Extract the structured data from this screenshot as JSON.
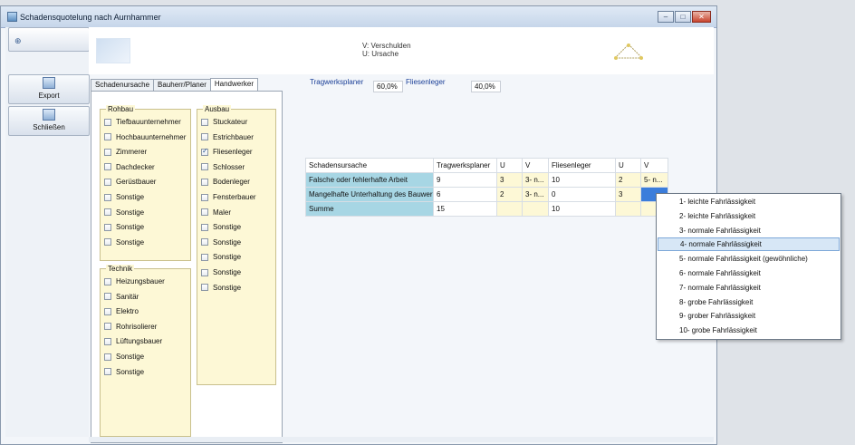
{
  "window": {
    "title": "Schadensquotelung nach Aurnhammer",
    "controls": {
      "minimize": "–",
      "maximize": "□",
      "close": "✕"
    }
  },
  "sidebar": {
    "pin_icon": "pin-icon",
    "export_label": "Export",
    "close_label": "Schließen"
  },
  "header": {
    "legend_v": "V: Verschulden",
    "legend_u": "U: Ursache"
  },
  "tabs": [
    {
      "label": "Schadenursache",
      "active": false
    },
    {
      "label": "Bauherr/Planer",
      "active": false
    },
    {
      "label": "Handwerker",
      "active": true
    }
  ],
  "groups": {
    "rohbau": {
      "title": "Rohbau",
      "items": [
        {
          "label": "Tiefbauunternehmer",
          "checked": false
        },
        {
          "label": "Hochbauunternehmer",
          "checked": false
        },
        {
          "label": "Zimmerer",
          "checked": false
        },
        {
          "label": "Dachdecker",
          "checked": false
        },
        {
          "label": "Gerüstbauer",
          "checked": false
        },
        {
          "label": "Sonstige",
          "checked": false
        },
        {
          "label": "Sonstige",
          "checked": false
        },
        {
          "label": "Sonstige",
          "checked": false
        },
        {
          "label": "Sonstige",
          "checked": false
        }
      ]
    },
    "ausbau": {
      "title": "Ausbau",
      "items": [
        {
          "label": "Stuckateur",
          "checked": false
        },
        {
          "label": "Estrichbauer",
          "checked": false
        },
        {
          "label": "Fliesenleger",
          "checked": true
        },
        {
          "label": "Schlosser",
          "checked": false
        },
        {
          "label": "Bodenleger",
          "checked": false
        },
        {
          "label": "Fensterbauer",
          "checked": false
        },
        {
          "label": "Maler",
          "checked": false
        },
        {
          "label": "Sonstige",
          "checked": false
        },
        {
          "label": "Sonstige",
          "checked": false
        },
        {
          "label": "Sonstige",
          "checked": false
        },
        {
          "label": "Sonstige",
          "checked": false
        },
        {
          "label": "Sonstige",
          "checked": false
        }
      ]
    },
    "technik": {
      "title": "Technik",
      "items": [
        {
          "label": "Heizungsbauer",
          "checked": false
        },
        {
          "label": "Sanitär",
          "checked": false
        },
        {
          "label": "Elektro",
          "checked": false
        },
        {
          "label": "Rohrisolierer",
          "checked": false
        },
        {
          "label": "Lüftungsbauer",
          "checked": false
        },
        {
          "label": "Sonstige",
          "checked": false
        },
        {
          "label": "Sonstige",
          "checked": false
        }
      ]
    }
  },
  "percentages": {
    "tragwerksplaner_label": "Tragwerksplaner",
    "tragwerksplaner_value": "60,0%",
    "fliesenleger_label": "Fliesenleger",
    "fliesenleger_value": "40,0%"
  },
  "grid": {
    "headers": [
      "Schadensursache",
      "Tragwerksplaner",
      "U",
      "V",
      "Fliesenleger",
      "U",
      "V"
    ],
    "rows": [
      [
        "Falsche oder fehlerhafte Arbeit",
        "9",
        "3",
        "3- n...",
        "10",
        "2",
        "5- n..."
      ],
      [
        "Mangelhafte Unterhaltung des Bauwerks",
        "6",
        "2",
        "3- n...",
        "0",
        "3",
        ""
      ],
      [
        "Summe",
        "15",
        "",
        "",
        "10",
        "",
        ""
      ]
    ]
  },
  "dropdown": {
    "options": [
      "1- leichte Fahrlässigkeit",
      "2- leichte Fahrlässigkeit",
      "3- normale Fahrlässigkeit",
      "4- normale Fahrlässigkeit",
      "5- normale Fahrlässigkeit (gewöhnliche)",
      "6- normale Fahrlässigkeit",
      "7- normale Fahrlässigkeit",
      "8- grobe Fahrlässigkeit",
      "9- grober Fahrlässigkeit",
      "10- grobe Fahrlässigkeit"
    ],
    "selected_index": 3
  },
  "colors": {
    "row_header": "#a7d6e4",
    "group_fill": "#fdf8d6",
    "selection": "#3b7ddb",
    "percentage_label": "#1a3f97"
  }
}
